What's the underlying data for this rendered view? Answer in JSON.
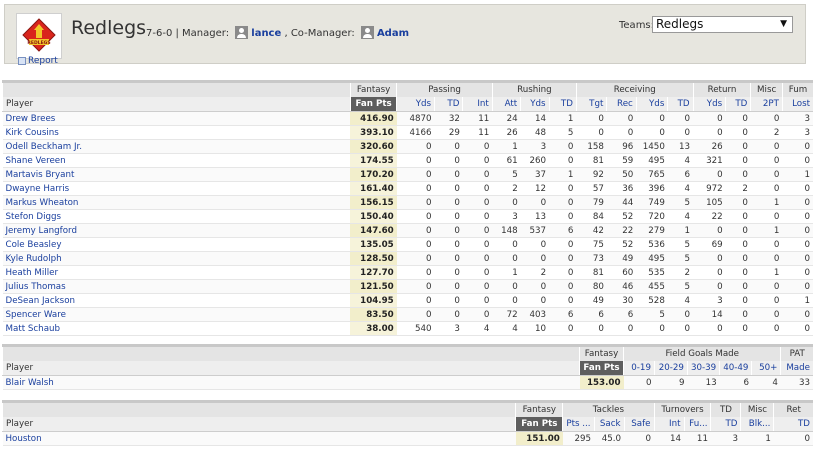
{
  "header": {
    "team_name": "Redlegs",
    "record": "7-6-0",
    "manager_label": "| Manager:",
    "manager_name": "lance",
    "comanager_label": ", Co-Manager:",
    "comanager_name": "Adam",
    "report_label": "Report",
    "teams_label": "Teams:",
    "teams_selected": "Redlegs",
    "logo_text": "REDLEGS"
  },
  "offense": {
    "groups": [
      "Fantasy",
      "Passing",
      "Rushing",
      "Receiving",
      "Return",
      "Misc",
      "Fum"
    ],
    "player_header": "Player",
    "fan_pts_header": "Fan Pts",
    "columns": [
      "Yds",
      "TD",
      "Int",
      "Att",
      "Yds",
      "TD",
      "Tgt",
      "Rec",
      "Yds",
      "TD",
      "Yds",
      "TD",
      "2PT",
      "Lost"
    ],
    "rows": [
      {
        "name": "Drew Brees",
        "pts": "416.90",
        "s": [
          "4870",
          "32",
          "11",
          "24",
          "14",
          "1",
          "0",
          "0",
          "0",
          "0",
          "0",
          "0",
          "0",
          "3"
        ]
      },
      {
        "name": "Kirk Cousins",
        "pts": "393.10",
        "s": [
          "4166",
          "29",
          "11",
          "26",
          "48",
          "5",
          "0",
          "0",
          "0",
          "0",
          "0",
          "0",
          "2",
          "3"
        ]
      },
      {
        "name": "Odell Beckham Jr.",
        "pts": "320.60",
        "s": [
          "0",
          "0",
          "0",
          "1",
          "3",
          "0",
          "158",
          "96",
          "1450",
          "13",
          "26",
          "0",
          "0",
          "0"
        ]
      },
      {
        "name": "Shane Vereen",
        "pts": "174.55",
        "s": [
          "0",
          "0",
          "0",
          "61",
          "260",
          "0",
          "81",
          "59",
          "495",
          "4",
          "321",
          "0",
          "0",
          "0"
        ]
      },
      {
        "name": "Martavis Bryant",
        "pts": "170.20",
        "s": [
          "0",
          "0",
          "0",
          "5",
          "37",
          "1",
          "92",
          "50",
          "765",
          "6",
          "0",
          "0",
          "0",
          "1"
        ]
      },
      {
        "name": "Dwayne Harris",
        "pts": "161.40",
        "s": [
          "0",
          "0",
          "0",
          "2",
          "12",
          "0",
          "57",
          "36",
          "396",
          "4",
          "972",
          "2",
          "0",
          "0"
        ]
      },
      {
        "name": "Markus Wheaton",
        "pts": "156.15",
        "s": [
          "0",
          "0",
          "0",
          "0",
          "0",
          "0",
          "79",
          "44",
          "749",
          "5",
          "105",
          "0",
          "1",
          "0"
        ]
      },
      {
        "name": "Stefon Diggs",
        "pts": "150.40",
        "s": [
          "0",
          "0",
          "0",
          "3",
          "13",
          "0",
          "84",
          "52",
          "720",
          "4",
          "22",
          "0",
          "0",
          "0"
        ]
      },
      {
        "name": "Jeremy Langford",
        "pts": "147.60",
        "s": [
          "0",
          "0",
          "0",
          "148",
          "537",
          "6",
          "42",
          "22",
          "279",
          "1",
          "0",
          "0",
          "1",
          "0"
        ]
      },
      {
        "name": "Cole Beasley",
        "pts": "135.05",
        "s": [
          "0",
          "0",
          "0",
          "0",
          "0",
          "0",
          "75",
          "52",
          "536",
          "5",
          "69",
          "0",
          "0",
          "0"
        ]
      },
      {
        "name": "Kyle Rudolph",
        "pts": "128.50",
        "s": [
          "0",
          "0",
          "0",
          "0",
          "0",
          "0",
          "73",
          "49",
          "495",
          "5",
          "0",
          "0",
          "0",
          "0"
        ]
      },
      {
        "name": "Heath Miller",
        "pts": "127.70",
        "s": [
          "0",
          "0",
          "0",
          "1",
          "2",
          "0",
          "81",
          "60",
          "535",
          "2",
          "0",
          "0",
          "1",
          "0"
        ]
      },
      {
        "name": "Julius Thomas",
        "pts": "121.50",
        "s": [
          "0",
          "0",
          "0",
          "0",
          "0",
          "0",
          "80",
          "46",
          "455",
          "5",
          "0",
          "0",
          "0",
          "0"
        ]
      },
      {
        "name": "DeSean Jackson",
        "pts": "104.95",
        "s": [
          "0",
          "0",
          "0",
          "0",
          "0",
          "0",
          "49",
          "30",
          "528",
          "4",
          "3",
          "0",
          "0",
          "1"
        ]
      },
      {
        "name": "Spencer Ware",
        "pts": "83.50",
        "s": [
          "0",
          "0",
          "0",
          "72",
          "403",
          "6",
          "6",
          "6",
          "5",
          "0",
          "14",
          "0",
          "0",
          "0"
        ]
      },
      {
        "name": "Matt Schaub",
        "pts": "38.00",
        "s": [
          "540",
          "3",
          "4",
          "4",
          "10",
          "0",
          "0",
          "0",
          "0",
          "0",
          "0",
          "0",
          "0",
          "0"
        ]
      }
    ]
  },
  "kicker": {
    "groups": [
      "Fantasy",
      "Field Goals Made",
      "PAT"
    ],
    "player_header": "Player",
    "fan_pts_header": "Fan Pts",
    "columns": [
      "0-19",
      "20-29",
      "30-39",
      "40-49",
      "50+",
      "Made"
    ],
    "rows": [
      {
        "name": "Blair Walsh",
        "pts": "153.00",
        "s": [
          "0",
          "9",
          "13",
          "6",
          "4",
          "33"
        ]
      }
    ]
  },
  "defense": {
    "groups": [
      "Fantasy",
      "Tackles",
      "Turnovers",
      "TD",
      "Misc",
      "Ret"
    ],
    "player_header": "Player",
    "fan_pts_header": "Fan Pts",
    "columns": [
      "Pts ...",
      "Sack",
      "Safe",
      "Int",
      "Fu...",
      "TD",
      "Blk...",
      "TD"
    ],
    "rows": [
      {
        "name": "Houston",
        "pts": "151.00",
        "s": [
          "295",
          "45.0",
          "0",
          "14",
          "11",
          "3",
          "1",
          "0"
        ]
      }
    ]
  },
  "colors": {
    "header_bg": "#e7e6df",
    "link": "#1a3f9e",
    "fan_pts_header_bg": "#5e5e5e",
    "fan_pts_cell_bg": "#f6f3da"
  }
}
